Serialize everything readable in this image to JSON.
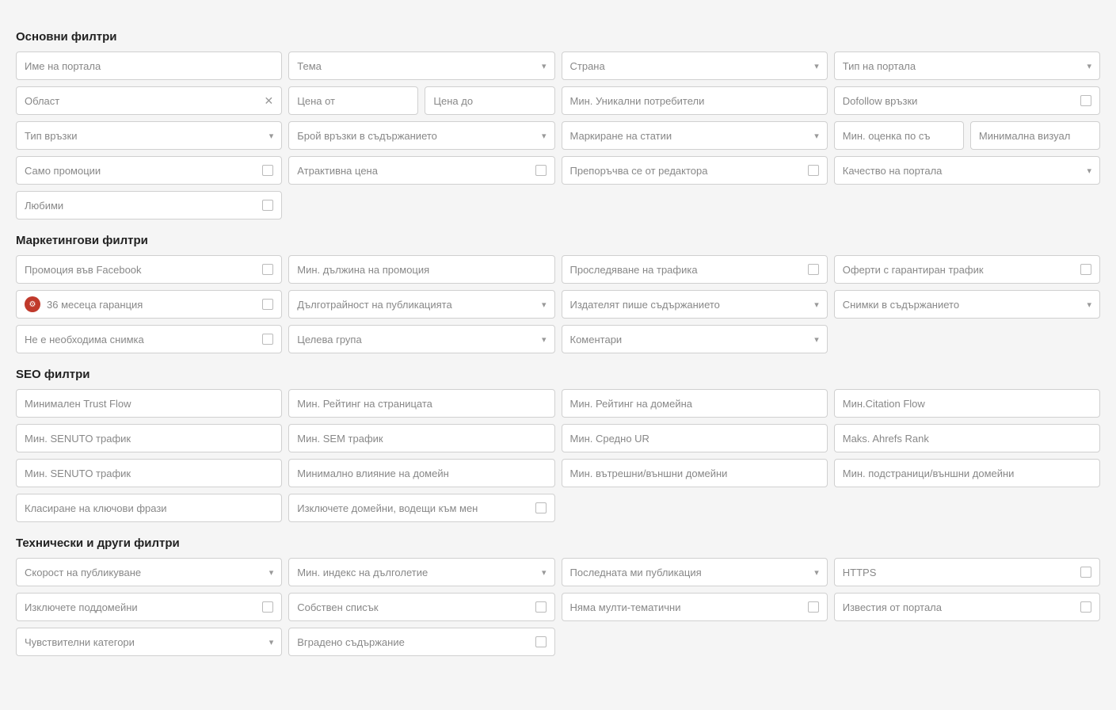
{
  "sections": [
    {
      "id": "basic-filters",
      "title": "Основни филтри",
      "rows": [
        [
          {
            "id": "portal-name",
            "label": "Име на портала",
            "type": "text"
          },
          {
            "id": "topic",
            "label": "Тема",
            "type": "dropdown"
          },
          {
            "id": "country",
            "label": "Страна",
            "type": "dropdown"
          },
          {
            "id": "portal-type",
            "label": "Тип на портала",
            "type": "dropdown"
          }
        ],
        [
          {
            "id": "region",
            "label": "Област",
            "type": "text-clear"
          },
          {
            "id": "price-range",
            "label": null,
            "type": "price-range",
            "from": "Цена от",
            "to": "Цена до"
          },
          {
            "id": "min-unique-users",
            "label": "Мин. Уникални потребители",
            "type": "text"
          },
          {
            "id": "dofollow",
            "label": "Dofollow връзки",
            "type": "checkbox"
          }
        ],
        [
          {
            "id": "link-type",
            "label": "Тип връзки",
            "type": "dropdown"
          },
          {
            "id": "links-in-content",
            "label": "Брой връзки в съдържанието",
            "type": "dropdown"
          },
          {
            "id": "article-marking",
            "label": "Маркиране на статии",
            "type": "dropdown"
          },
          {
            "id": "min-rating-two",
            "label": null,
            "type": "double-text",
            "a": "Мин. оценка по съ",
            "b": "Минимална визуал"
          }
        ],
        [
          {
            "id": "only-promos",
            "label": "Само промоции",
            "type": "checkbox"
          },
          {
            "id": "attractive-price",
            "label": "Атрактивна цена",
            "type": "checkbox"
          },
          {
            "id": "editor-recommended",
            "label": "Препоръчва се от редактора",
            "type": "checkbox"
          },
          {
            "id": "portal-quality",
            "label": "Качество на портала",
            "type": "dropdown"
          }
        ],
        [
          {
            "id": "favorites",
            "label": "Любими",
            "type": "checkbox"
          }
        ]
      ]
    },
    {
      "id": "marketing-filters",
      "title": "Маркетингови филтри",
      "rows": [
        [
          {
            "id": "facebook-promo",
            "label": "Промоция във Facebook",
            "type": "checkbox"
          },
          {
            "id": "min-promo-length",
            "label": "Мин. дължина на промоция",
            "type": "text"
          },
          {
            "id": "traffic-tracking",
            "label": "Проследяване на трафика",
            "type": "checkbox"
          },
          {
            "id": "guaranteed-traffic",
            "label": "Оферти с гарантиран трафик",
            "type": "checkbox"
          }
        ],
        [
          {
            "id": "guarantee-36",
            "label": "36 месеца гаранция",
            "type": "checkbox-badge"
          },
          {
            "id": "longevity",
            "label": "Дълготрайност на публикацията",
            "type": "dropdown"
          },
          {
            "id": "publisher-writes",
            "label": "Издателят пише съдържанието",
            "type": "dropdown"
          },
          {
            "id": "images-in-content",
            "label": "Снимки в съдържанието",
            "type": "dropdown"
          }
        ],
        [
          {
            "id": "no-image-needed",
            "label": "Не е необходима снимка",
            "type": "checkbox"
          },
          {
            "id": "target-group",
            "label": "Целева група",
            "type": "dropdown"
          },
          {
            "id": "comments",
            "label": "Коментари",
            "type": "dropdown"
          }
        ]
      ]
    },
    {
      "id": "seo-filters",
      "title": "SEO филтри",
      "rows": [
        [
          {
            "id": "min-trust-flow",
            "label": "Минимален Trust Flow",
            "type": "text"
          },
          {
            "id": "min-page-rating",
            "label": "Мин. Рейтинг на страницата",
            "type": "text"
          },
          {
            "id": "min-domain-rating",
            "label": "Мин. Рейтинг на домейна",
            "type": "text"
          },
          {
            "id": "min-citation-flow",
            "label": "Мин.Citation Flow",
            "type": "text"
          }
        ],
        [
          {
            "id": "min-senuto-traffic",
            "label": "Мин. SENUTO трафик",
            "type": "text"
          },
          {
            "id": "min-sem-traffic",
            "label": "Мин. SEM трафик",
            "type": "text"
          },
          {
            "id": "min-avg-ur",
            "label": "Мин. Средно UR",
            "type": "text"
          },
          {
            "id": "max-ahrefs-rank",
            "label": "Maks. Ahrefs Rank",
            "type": "text"
          }
        ],
        [
          {
            "id": "min-senuto-traffic2",
            "label": "Мин. SENUTO трафик",
            "type": "text"
          },
          {
            "id": "min-domain-influence",
            "label": "Минимално влияние на домейн",
            "type": "text"
          },
          {
            "id": "min-int-ext-domains",
            "label": "Мин. вътрешни/външни домейни",
            "type": "text"
          },
          {
            "id": "min-subpages-ext",
            "label": "Мин. подстраници/външни домейни",
            "type": "text"
          }
        ],
        [
          {
            "id": "keyword-ranking",
            "label": "Класиране на ключови фрази",
            "type": "text"
          },
          {
            "id": "exclude-domains-me",
            "label": "Изключете домейни, водещи към мен",
            "type": "checkbox"
          }
        ]
      ]
    },
    {
      "id": "technical-filters",
      "title": "Технически и други филтри",
      "rows": [
        [
          {
            "id": "publish-speed",
            "label": "Скорост на публикуване",
            "type": "dropdown"
          },
          {
            "id": "min-longevity-index",
            "label": "Мин. индекс на дълголетие",
            "type": "dropdown"
          },
          {
            "id": "last-my-publication",
            "label": "Последната ми публикация",
            "type": "dropdown"
          },
          {
            "id": "https",
            "label": "HTTPS",
            "type": "checkbox"
          }
        ],
        [
          {
            "id": "exclude-subdomains",
            "label": "Изключете поддомейни",
            "type": "checkbox"
          },
          {
            "id": "own-list",
            "label": "Собствен списък",
            "type": "checkbox"
          },
          {
            "id": "no-multi-thematic",
            "label": "Няма мулти-тематични",
            "type": "checkbox"
          },
          {
            "id": "portal-notifications",
            "label": "Известия от портала",
            "type": "checkbox"
          }
        ],
        [
          {
            "id": "sensitive-categories",
            "label": "Чувствителни категори",
            "type": "dropdown"
          },
          {
            "id": "embedded-content",
            "label": "Вградено съдържание",
            "type": "checkbox"
          }
        ]
      ]
    }
  ]
}
